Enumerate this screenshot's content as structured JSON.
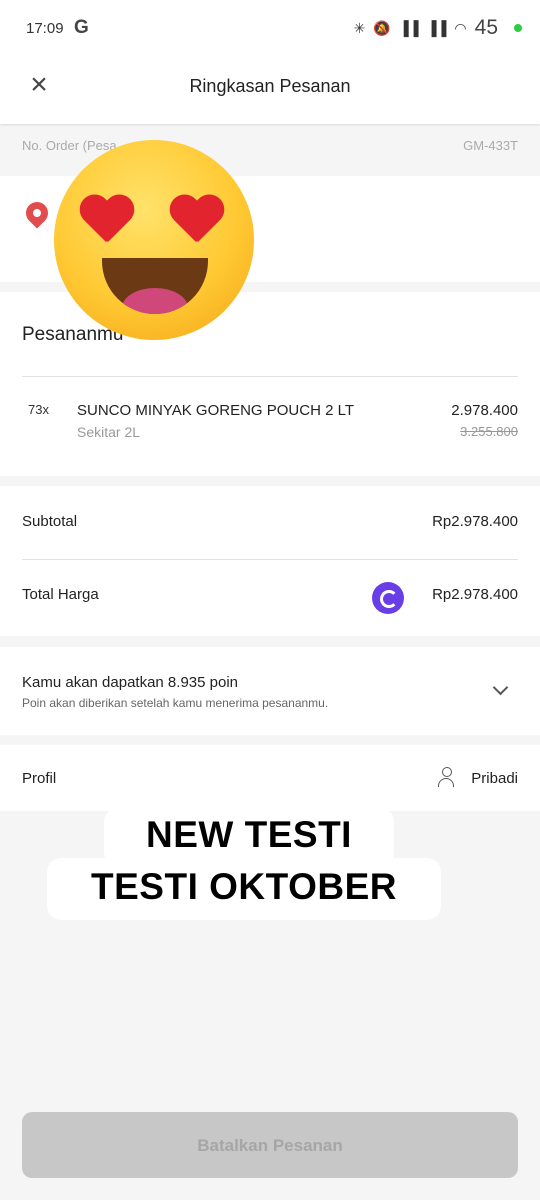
{
  "status_bar": {
    "time": "17:09",
    "g_icon": "G",
    "battery": "45",
    "icons": [
      "bluetooth-icon",
      "bell-off-icon",
      "signal-icon",
      "signal-icon",
      "wifi-icon"
    ]
  },
  "header": {
    "title": "Ringkasan Pesanan",
    "close_icon": "×"
  },
  "order": {
    "label": "No. Order (Pesa",
    "value": "GM-433T"
  },
  "orders": {
    "heading": "Pesananmu",
    "items": [
      {
        "qty": "73x",
        "name": "SUNCO MINYAK GORENG POUCH 2 LT",
        "variant": "Sekitar 2L",
        "price": "2.978.400",
        "old_price": "3.255.800"
      }
    ]
  },
  "totals": {
    "subtotal_label": "Subtotal",
    "subtotal_value": "Rp2.978.400",
    "total_label": "Total Harga",
    "total_value": "Rp2.978.400"
  },
  "points": {
    "title": "Kamu akan dapatkan 8.935 poin",
    "subtitle": "Poin akan diberikan setelah kamu menerima pesananmu."
  },
  "profile": {
    "label": "Profil",
    "value": "Pribadi"
  },
  "overlay": {
    "line1": "NEW TESTI",
    "line2": "TESTI OKTOBER"
  },
  "cancel_button": "Batalkan Pesanan",
  "colors": {
    "pin": "#e24c4c",
    "coin": "#6a3ee6",
    "button_disabled": "#c7c7c7"
  }
}
